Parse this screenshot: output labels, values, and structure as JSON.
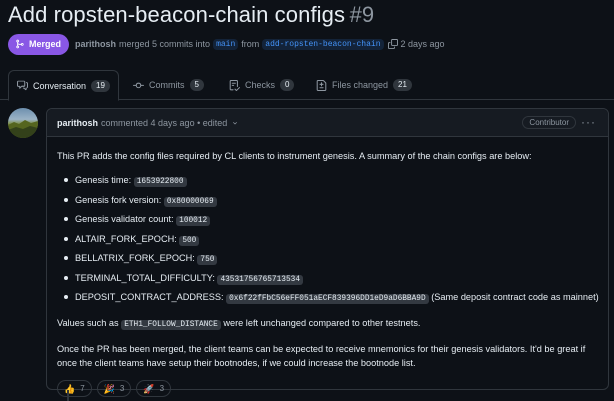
{
  "header": {
    "title": "Add ropsten-beacon-chain configs",
    "number": "#9",
    "state_label": "Merged",
    "author": "parithosh",
    "merged_text": "merged 5 commits into",
    "base_branch": "main",
    "from_text": "from",
    "head_branch": "add-ropsten-beacon-chain",
    "time": "2 days ago"
  },
  "tabs": [
    {
      "label": "Conversation",
      "count": "19",
      "icon": "comment-discussion-icon",
      "active": true
    },
    {
      "label": "Commits",
      "count": "5",
      "icon": "git-commit-icon",
      "active": false
    },
    {
      "label": "Checks",
      "count": "0",
      "icon": "checklist-icon",
      "active": false
    },
    {
      "label": "Files changed",
      "count": "21",
      "icon": "file-diff-icon",
      "active": false
    }
  ],
  "comment": {
    "author": "parithosh",
    "meta": "commented 4 days ago • edited",
    "role": "Contributor",
    "intro": "This PR adds the config files required by CL clients to instrument genesis. A summary of the chain configs are below:",
    "items": [
      {
        "label": "Genesis time:",
        "code": "1653922800",
        "suffix": ""
      },
      {
        "label": "Genesis fork version:",
        "code": "0x80000069",
        "suffix": ""
      },
      {
        "label": "Genesis validator count:",
        "code": "100012",
        "suffix": ""
      },
      {
        "label": "ALTAIR_FORK_EPOCH:",
        "code": "500",
        "suffix": ""
      },
      {
        "label": "BELLATRIX_FORK_EPOCH:",
        "code": "750",
        "suffix": ""
      },
      {
        "label": "TERMINAL_TOTAL_DIFFICULTY:",
        "code": "43531756765713534",
        "suffix": ""
      },
      {
        "label": "DEPOSIT_CONTRACT_ADDRESS:",
        "code": "0x6f22fFbC56eFF051aECF839396DD1eD9aD6BBA9D",
        "suffix": "(Same deposit contract code as mainnet)"
      }
    ],
    "para2_before": "Values such as",
    "para2_code": "ETH1_FOLLOW_DISTANCE",
    "para2_after": "were left unchanged compared to other testnets.",
    "para3": "Once the PR has been merged, the client teams can be expected to receive mnemonics for their genesis validators. It'd be great if once the client teams have setup their bootnodes, if we could increase the bootnode list.",
    "reactions": [
      {
        "emoji": "👍",
        "count": "7"
      },
      {
        "emoji": "🎉",
        "count": "3"
      },
      {
        "emoji": "🚀",
        "count": "3"
      }
    ]
  }
}
